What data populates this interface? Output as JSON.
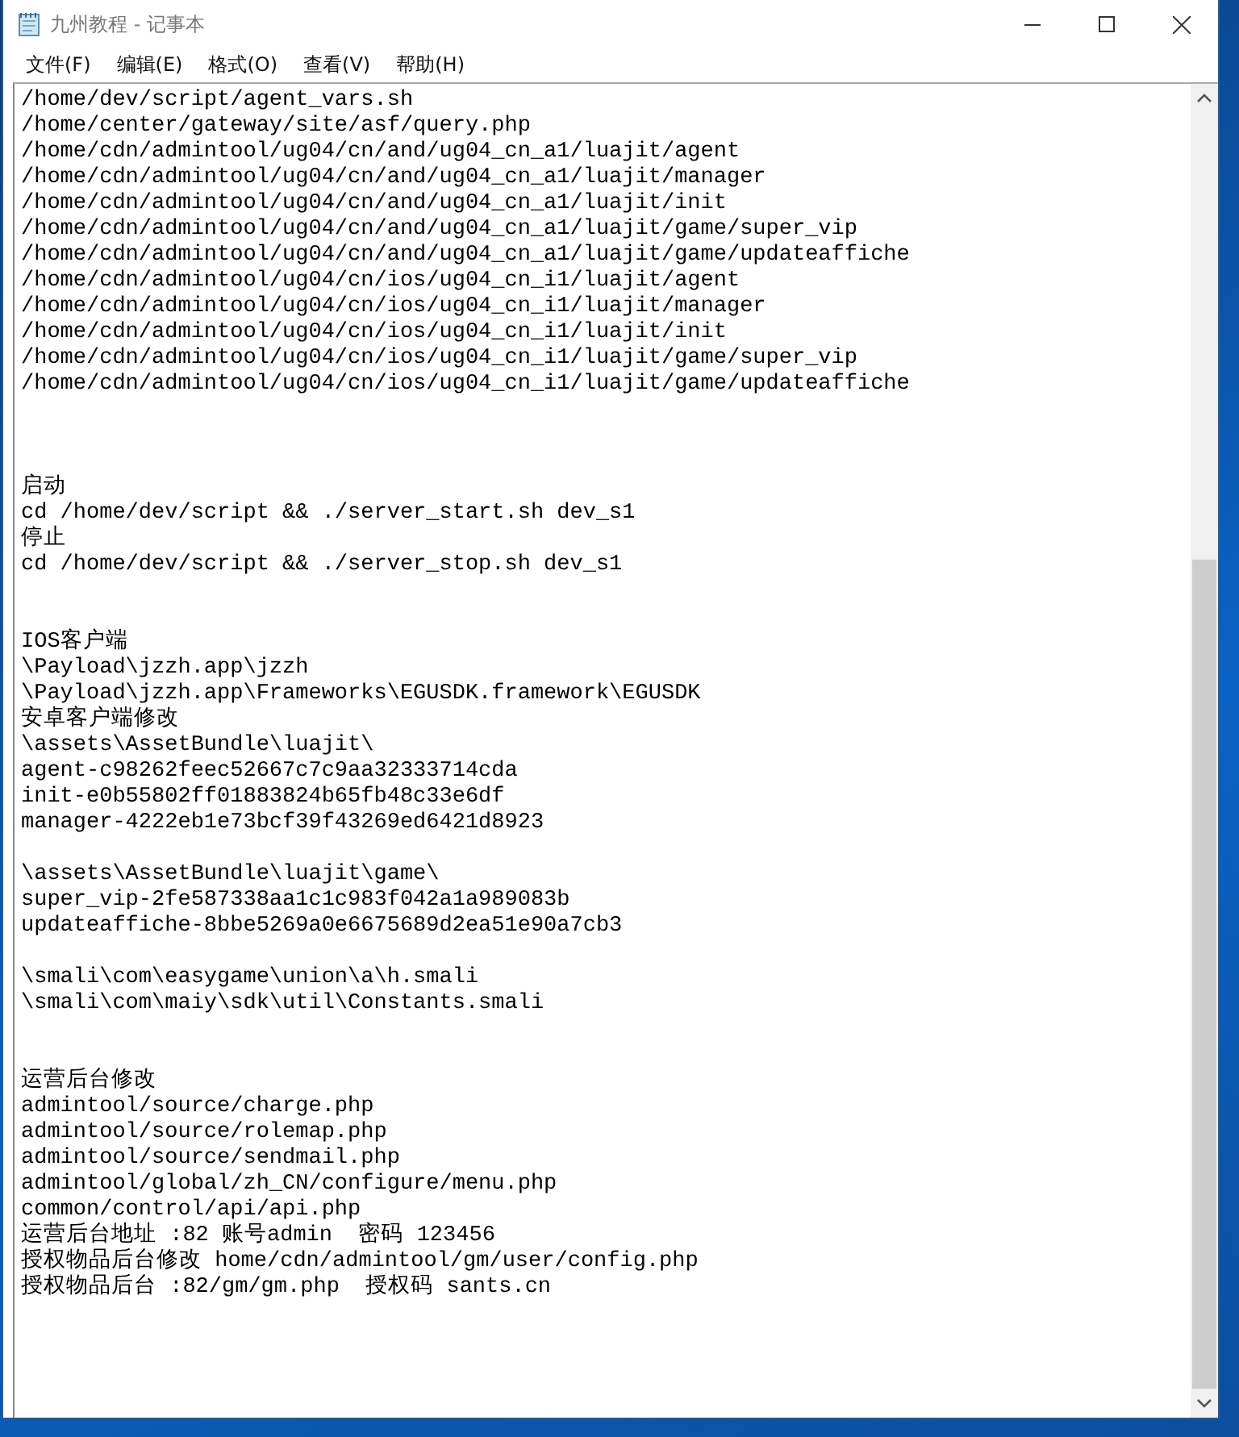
{
  "window": {
    "title": "九州教程 - 记事本"
  },
  "menu": [
    "文件(F)",
    "编辑(E)",
    "格式(O)",
    "查看(V)",
    "帮助(H)"
  ],
  "lines": [
    {
      "kind": "text",
      "text": "/home/dev/script/agent_vars.sh"
    },
    {
      "kind": "text",
      "text": "/home/center/gateway/site/asf/query.php"
    },
    {
      "kind": "text",
      "text": "/home/cdn/admintool/ug04/cn/and/ug04_cn_a1/luajit/agent"
    },
    {
      "kind": "text",
      "text": "/home/cdn/admintool/ug04/cn/and/ug04_cn_a1/luajit/manager"
    },
    {
      "kind": "text",
      "text": "/home/cdn/admintool/ug04/cn/and/ug04_cn_a1/luajit/init"
    },
    {
      "kind": "text",
      "text": "/home/cdn/admintool/ug04/cn/and/ug04_cn_a1/luajit/game/super_vip"
    },
    {
      "kind": "text",
      "text": "/home/cdn/admintool/ug04/cn/and/ug04_cn_a1/luajit/game/updateaffiche"
    },
    {
      "kind": "text",
      "text": "/home/cdn/admintool/ug04/cn/ios/ug04_cn_i1/luajit/agent"
    },
    {
      "kind": "text",
      "text": "/home/cdn/admintool/ug04/cn/ios/ug04_cn_i1/luajit/manager"
    },
    {
      "kind": "text",
      "text": "/home/cdn/admintool/ug04/cn/ios/ug04_cn_i1/luajit/init"
    },
    {
      "kind": "text",
      "text": "/home/cdn/admintool/ug04/cn/ios/ug04_cn_i1/luajit/game/super_vip"
    },
    {
      "kind": "text",
      "text": "/home/cdn/admintool/ug04/cn/ios/ug04_cn_i1/luajit/game/updateaffiche"
    },
    {
      "kind": "blank"
    },
    {
      "kind": "blank"
    },
    {
      "kind": "blank"
    },
    {
      "kind": "text",
      "text": "启动"
    },
    {
      "kind": "text",
      "text": "cd /home/dev/script && ./server_start.sh dev_s1"
    },
    {
      "kind": "text",
      "text": "停止"
    },
    {
      "kind": "text",
      "text": "cd /home/dev/script && ./server_stop.sh dev_s1"
    },
    {
      "kind": "blank"
    },
    {
      "kind": "blank"
    },
    {
      "kind": "text",
      "text": "IOS客户端"
    },
    {
      "kind": "text",
      "text": "\\Payload\\jzzh.app\\jzzh"
    },
    {
      "kind": "text",
      "text": "\\Payload\\jzzh.app\\Frameworks\\EGUSDK.framework\\EGUSDK"
    },
    {
      "kind": "text",
      "text": "安卓客户端修改"
    },
    {
      "kind": "text",
      "text": "\\assets\\AssetBundle\\luajit\\"
    },
    {
      "kind": "text",
      "text": "agent-c98262feec52667c7c9aa32333714cda"
    },
    {
      "kind": "text",
      "text": "init-e0b55802ff01883824b65fb48c33e6df"
    },
    {
      "kind": "text",
      "text": "manager-4222eb1e73bcf39f43269ed6421d8923"
    },
    {
      "kind": "blank"
    },
    {
      "kind": "text",
      "text": "\\assets\\AssetBundle\\luajit\\game\\"
    },
    {
      "kind": "text",
      "text": "super_vip-2fe587338aa1c1c983f042a1a989083b"
    },
    {
      "kind": "text",
      "text": "updateaffiche-8bbe5269a0e6675689d2ea51e90a7cb3"
    },
    {
      "kind": "blank"
    },
    {
      "kind": "text",
      "text": "\\smali\\com\\easygame\\union\\a\\h.smali"
    },
    {
      "kind": "text",
      "text": "\\smali\\com\\maiy\\sdk\\util\\Constants.smali"
    },
    {
      "kind": "blank"
    },
    {
      "kind": "blank"
    },
    {
      "kind": "text",
      "text": "运营后台修改"
    },
    {
      "kind": "text",
      "text": "admintool/source/charge.php"
    },
    {
      "kind": "text",
      "text": "admintool/source/rolemap.php"
    },
    {
      "kind": "text",
      "text": "admintool/source/sendmail.php"
    },
    {
      "kind": "text",
      "text": "admintool/global/zh_CN/configure/menu.php"
    },
    {
      "kind": "text",
      "text": "common/control/api/api.php"
    },
    {
      "kind": "text",
      "text": "运营后台地址 :82 账号admin  密码 123456"
    },
    {
      "kind": "text",
      "text": "授权物品后台修改 home/cdn/admintool/gm/user/config.php"
    },
    {
      "kind": "text",
      "text": "授权物品后台 :82/gm/gm.php  授权码 sants.cn"
    }
  ]
}
